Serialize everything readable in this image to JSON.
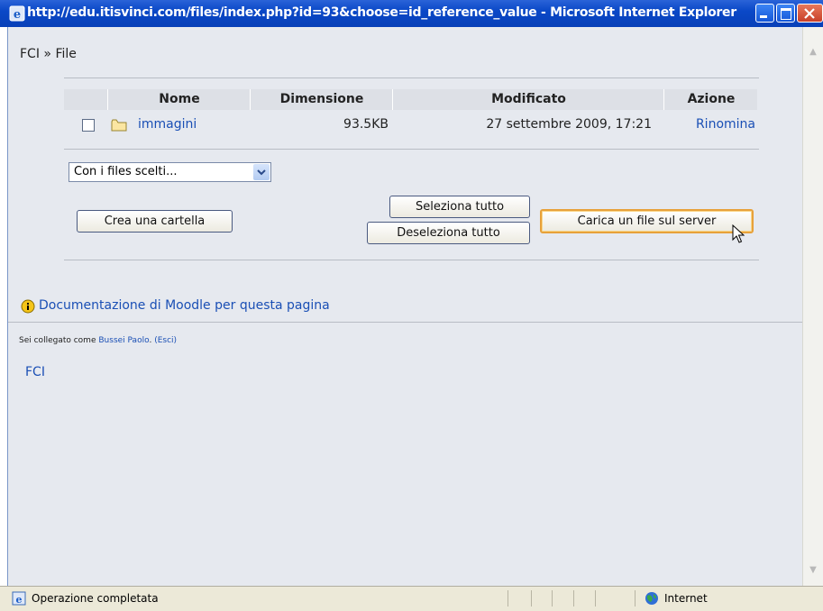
{
  "window": {
    "title": "http://edu.itisvinci.com/files/index.php?id=93&choose=id_reference_value - Microsoft Internet Explorer"
  },
  "breadcrumb": {
    "root": "FCI",
    "separator": "»",
    "current": "File"
  },
  "file_table": {
    "headers": [
      "Nome",
      "Dimensione",
      "Modificato",
      "Azione"
    ],
    "rows": [
      {
        "name": "immagini",
        "size": "93.5KB",
        "modified": "27 settembre 2009, 17:21",
        "action": "Rinomina"
      }
    ]
  },
  "bulk_action_select": {
    "selected": "Con i files scelti..."
  },
  "buttons": {
    "create_folder": "Crea una cartella",
    "select_all": "Seleziona tutto",
    "deselect_all": "Deseleziona tutto",
    "upload": "Carica un file sul server"
  },
  "docs_link": "Documentazione di Moodle per questa pagina",
  "login_info": {
    "prefix": "Sei collegato come",
    "user": "Bussei Paolo",
    "period": ".",
    "logout": "(Esci)"
  },
  "course_link": "FCI",
  "statusbar": {
    "text": "Operazione completata",
    "zone": "Internet"
  }
}
